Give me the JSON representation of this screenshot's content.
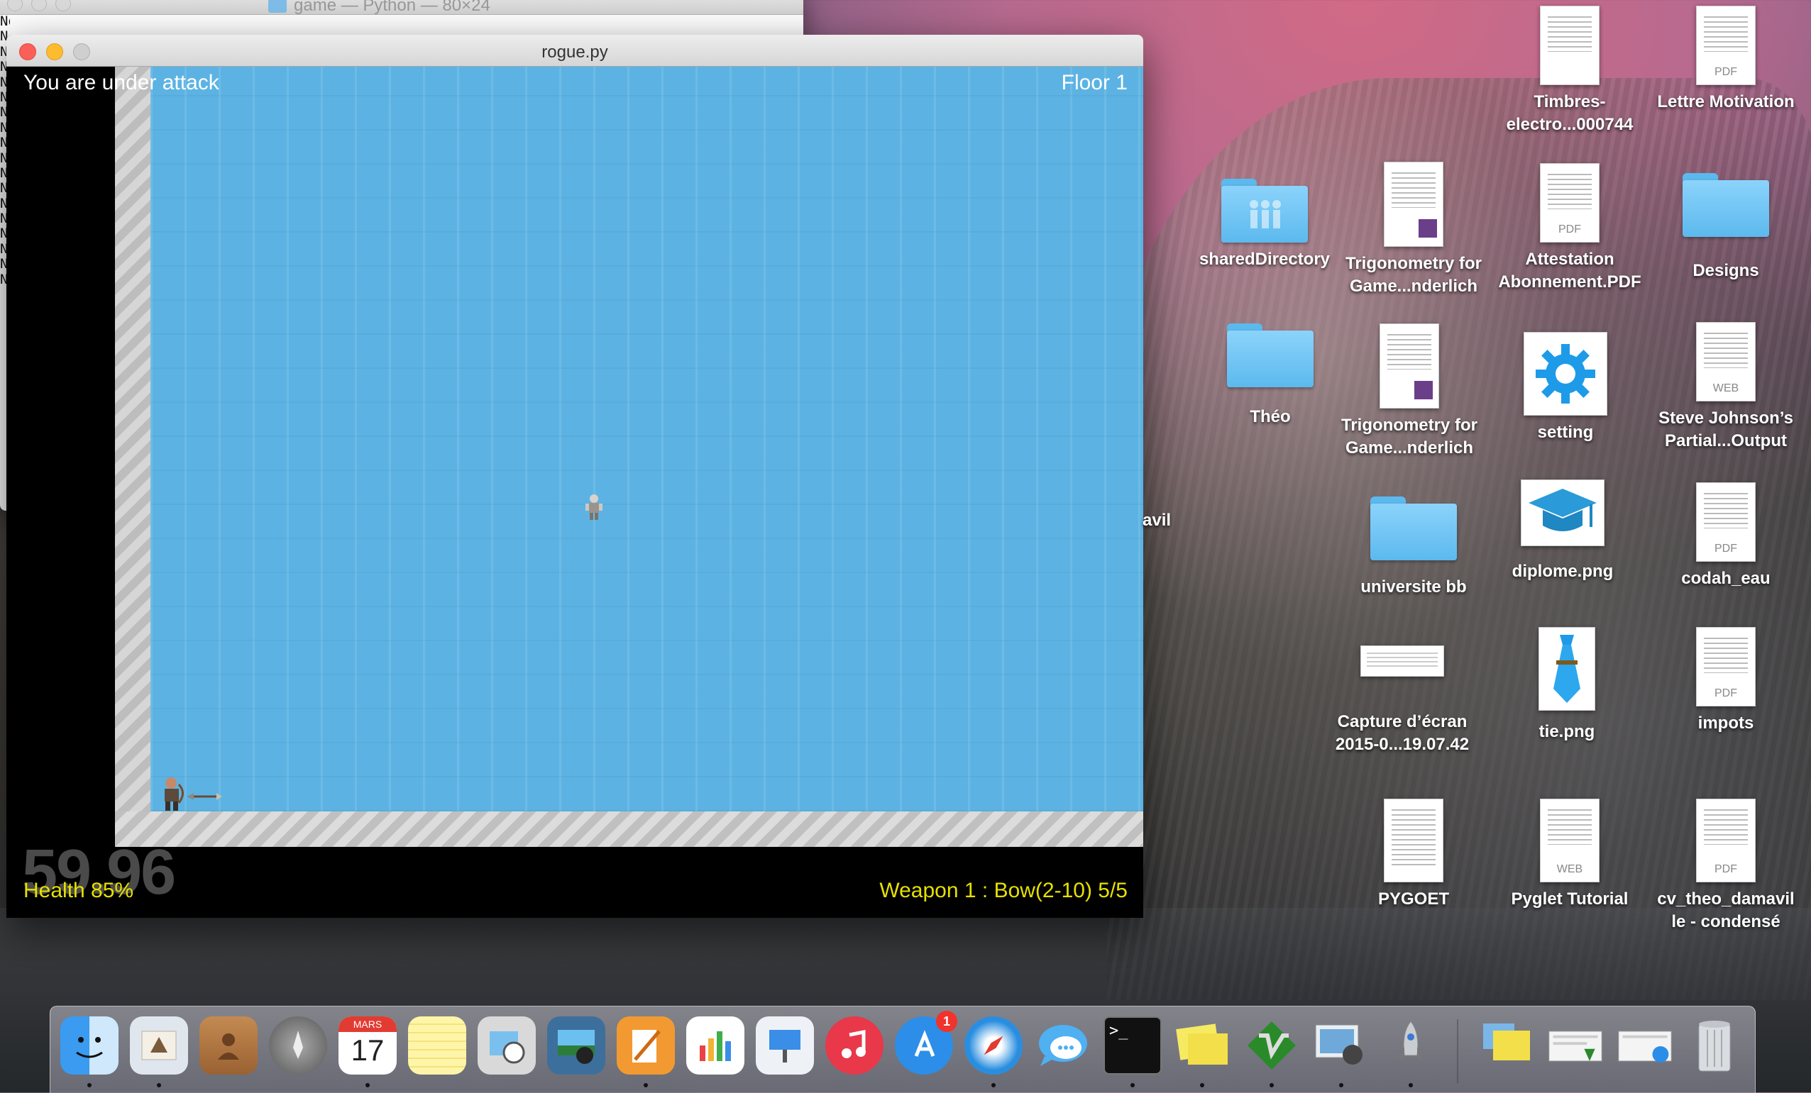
{
  "terminal": {
    "title": "game — Python — 80×24",
    "lines": [
      "None",
      "N",
      "N",
      "N",
      "N",
      "N",
      "N",
      "N",
      "N",
      "N",
      "N",
      "N",
      "N",
      "N",
      "N",
      "N",
      "N",
      "N"
    ]
  },
  "game_window": {
    "title": "rogue.py",
    "hud": {
      "status": "You are under attack",
      "floor": "Floor 1",
      "fps": "59.96",
      "health": "Health 85%",
      "weapon": "Weapon 1 : Bow(2-10) 5/5"
    }
  },
  "desktop": {
    "partial_label": "avil",
    "icons": [
      {
        "label": "Timbres-electro...000744",
        "kind": "doc"
      },
      {
        "label": "Lettre Motivation",
        "kind": "pdf",
        "tag": "PDF"
      },
      {
        "label": "sharedDirectory",
        "kind": "folder"
      },
      {
        "label": "Trigonometry for Game...nderlich",
        "kind": "doc"
      },
      {
        "label": "Attestation Abonnement.PDF",
        "kind": "pdf",
        "tag": "PDF"
      },
      {
        "label": "Designs",
        "kind": "folder"
      },
      {
        "label": "Théo",
        "kind": "folder"
      },
      {
        "label": "Trigonometry for Game...nderlich",
        "kind": "doc"
      },
      {
        "label": "setting",
        "kind": "image"
      },
      {
        "label": "Steve Johnson’s Partial...Output",
        "kind": "web",
        "tag": "WEB"
      },
      {
        "label": "universite bb",
        "kind": "folder"
      },
      {
        "label": "diplome.png",
        "kind": "image"
      },
      {
        "label": "codah_eau",
        "kind": "pdf",
        "tag": "PDF"
      },
      {
        "label": "Capture d’écran 2015-0...19.07.42",
        "kind": "image"
      },
      {
        "label": "tie.png",
        "kind": "image"
      },
      {
        "label": "impots",
        "kind": "pdf",
        "tag": "PDF"
      },
      {
        "label": "PYGOET",
        "kind": "doc"
      },
      {
        "label": "Pyglet Tutorial",
        "kind": "web",
        "tag": "WEB"
      },
      {
        "label": "cv_theo_damavil le - condensé",
        "kind": "pdf",
        "tag": "PDF"
      }
    ]
  },
  "dock": {
    "items": [
      {
        "name": "finder-icon"
      },
      {
        "name": "mail-icon"
      },
      {
        "name": "contacts-icon"
      },
      {
        "name": "launchpad-icon"
      },
      {
        "name": "calendar-icon",
        "month": "MARS",
        "day": "17"
      },
      {
        "name": "notes-icon"
      },
      {
        "name": "preview-icon"
      },
      {
        "name": "iphoto-icon"
      },
      {
        "name": "pages-icon"
      },
      {
        "name": "numbers-icon"
      },
      {
        "name": "keynote-icon"
      },
      {
        "name": "itunes-icon"
      },
      {
        "name": "app-store-icon",
        "badge": "1"
      },
      {
        "name": "safari-icon"
      },
      {
        "name": "messages-icon"
      },
      {
        "name": "terminal-icon",
        "text": ">_"
      },
      {
        "name": "stickies-icon"
      },
      {
        "name": "vim-icon"
      },
      {
        "name": "image-capture-icon"
      },
      {
        "name": "rocket-icon"
      },
      {
        "name": "applications-stack-icon"
      },
      {
        "name": "documents-stack-icon"
      },
      {
        "name": "downloads-stack-icon"
      },
      {
        "name": "trash-icon"
      }
    ]
  }
}
